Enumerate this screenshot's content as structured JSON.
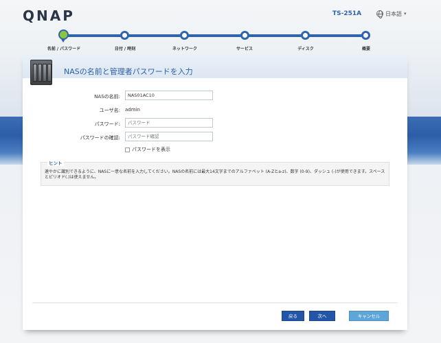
{
  "header": {
    "logo": "QNAP",
    "model": "TS-251A",
    "language": "日本語"
  },
  "steps": [
    {
      "label": "名前 / パスワード",
      "active": true
    },
    {
      "label": "日付 / 時刻",
      "active": false
    },
    {
      "label": "ネットワーク",
      "active": false
    },
    {
      "label": "サービス",
      "active": false
    },
    {
      "label": "ディスク",
      "active": false
    },
    {
      "label": "概要",
      "active": false
    }
  ],
  "panel": {
    "title": "NASの名前と管理者パスワードを入力"
  },
  "form": {
    "nas_name_label": "NASの名前:",
    "nas_name_value": "NAS01AC10",
    "username_label": "ユーザ名:",
    "username_value": "admin",
    "password_label": "パスワード:",
    "password_placeholder": "パスワード",
    "confirm_label": "パスワードの確認:",
    "confirm_placeholder": "パスワード確認",
    "show_password_label": "パスワードを表示"
  },
  "hint": {
    "title": "ヒント",
    "text": "速やかに識別できるように、NASに一意な名前を入力してください。NASの名前には最大14文字までのアルファベット (A-Zとa-z)、数字 (0-9)、ダッシュ (-)が使用できます。スペースとピリオド(.)は使えません。"
  },
  "buttons": {
    "back": "戻る",
    "next": "次へ",
    "cancel": "キャンセル"
  }
}
